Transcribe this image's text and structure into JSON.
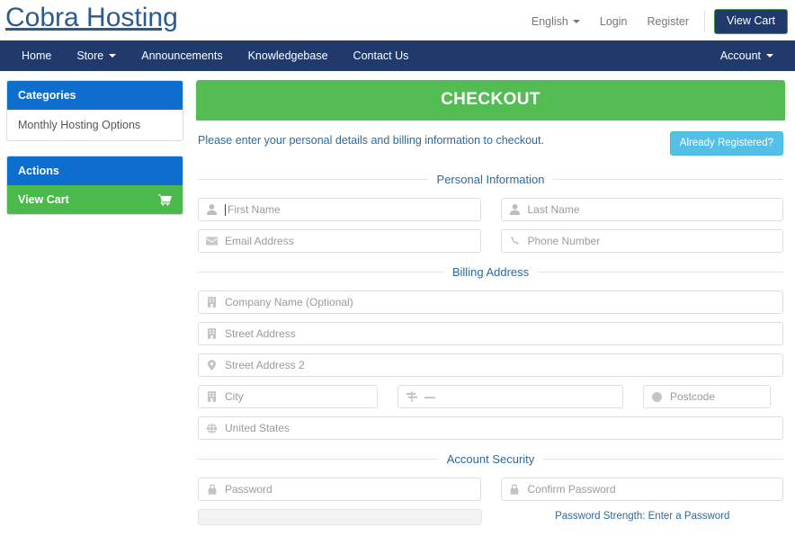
{
  "header": {
    "brand": "Cobra Hosting",
    "language": "English",
    "login": "Login",
    "register": "Register",
    "view_cart": "View Cart"
  },
  "navbar": {
    "items": [
      {
        "label": "Home",
        "caret": false
      },
      {
        "label": "Store",
        "caret": true
      },
      {
        "label": "Announcements",
        "caret": false
      },
      {
        "label": "Knowledgebase",
        "caret": false
      },
      {
        "label": "Contact Us",
        "caret": false
      }
    ],
    "account": "Account"
  },
  "sidebar": {
    "categories": {
      "title": "Categories",
      "items": [
        "Monthly Hosting Options"
      ]
    },
    "actions": {
      "title": "Actions",
      "view_cart": "View Cart"
    }
  },
  "main": {
    "checkout_title": "CHECKOUT",
    "intro": "Please enter your personal details and billing information to checkout.",
    "already_registered": "Already Registered?",
    "sections": {
      "personal": "Personal Information",
      "billing": "Billing Address",
      "security": "Account Security"
    },
    "fields": {
      "first_name": {
        "placeholder": "First Name",
        "value": "",
        "icon": "user-icon",
        "focused": true
      },
      "last_name": {
        "placeholder": "Last Name",
        "value": "",
        "icon": "user-icon"
      },
      "email": {
        "placeholder": "Email Address",
        "value": "",
        "icon": "envelope-icon"
      },
      "phone": {
        "placeholder": "Phone Number",
        "value": "",
        "icon": "phone-icon"
      },
      "company": {
        "placeholder": "Company Name (Optional)",
        "value": "",
        "icon": "building-icon"
      },
      "street1": {
        "placeholder": "Street Address",
        "value": "",
        "icon": "building-icon"
      },
      "street2": {
        "placeholder": "Street Address 2",
        "value": "",
        "icon": "map-marker-icon"
      },
      "city": {
        "placeholder": "City",
        "value": "",
        "icon": "building-icon"
      },
      "state": {
        "placeholder": "—",
        "value": "—",
        "icon": "map-signs-icon"
      },
      "postcode": {
        "placeholder": "Postcode",
        "value": "",
        "icon": "circle-icon"
      },
      "country": {
        "placeholder": "United States",
        "value": "United States",
        "icon": "globe-icon"
      },
      "password": {
        "placeholder": "Password",
        "value": "",
        "icon": "lock-icon"
      },
      "confirm_password": {
        "placeholder": "Confirm Password",
        "value": "",
        "icon": "lock-icon"
      }
    },
    "password_strength": "Password Strength: Enter a Password"
  },
  "colors": {
    "navy": "#203a6b",
    "brand_blue": "#2b5b8c",
    "panel_blue": "#0d6ecd",
    "green": "#53bd53",
    "info_blue": "#54c0e8",
    "link_blue": "#2c6a9e"
  }
}
